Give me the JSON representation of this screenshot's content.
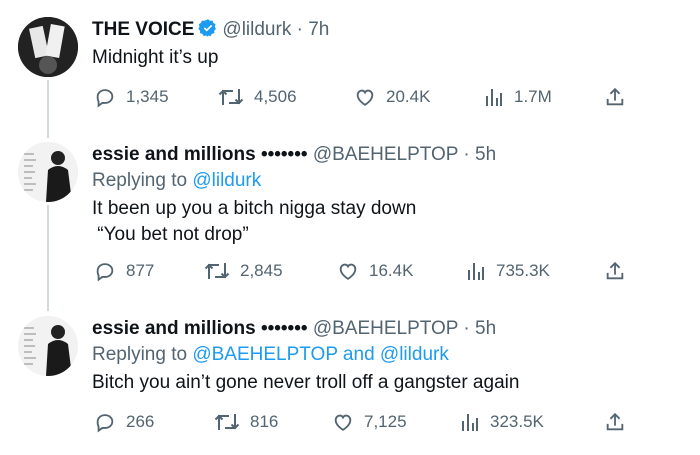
{
  "tweets": [
    {
      "name": "THE VOICE",
      "handle": "@lildurk",
      "time": "· 7h",
      "verified": true,
      "text": "Midnight it’s up",
      "stats": {
        "replies": "1,345",
        "retweets": "4,506",
        "likes": "20.4K",
        "views": "1.7M"
      }
    },
    {
      "name": "essie and millions",
      "name_dots": "•••••••",
      "handle": "@BAEHELPTOP",
      "time": "· 5h",
      "replying_prefix": "Replying to ",
      "replying_to": "@lildurk",
      "text_line1": "It been up you a bitch nigga stay down",
      "text_line2": " “You bet not drop”",
      "stats": {
        "replies": "877",
        "retweets": "2,845",
        "likes": "16.4K",
        "views": "735.3K"
      }
    },
    {
      "name": "essie and millions",
      "name_dots": "•••••••",
      "handle": "@BAEHELPTOP",
      "time": "· 5h",
      "replying_prefix": "Replying to ",
      "replying_to_1": "@BAEHELPTOP",
      "replying_and": " and ",
      "replying_to_2": "@lildurk",
      "text": "Bitch you ain’t gone never troll off a gangster again",
      "stats": {
        "replies": "266",
        "retweets": "816",
        "likes": "7,125",
        "views": "323.5K"
      }
    }
  ],
  "colors": {
    "link": "#1d9bf0",
    "verified": "#1d9bf0",
    "muted": "#536471",
    "thread_line": "#cfd9de"
  },
  "icons": [
    "reply-icon",
    "retweet-icon",
    "like-icon",
    "views-icon",
    "share-icon",
    "verified-badge-icon"
  ]
}
